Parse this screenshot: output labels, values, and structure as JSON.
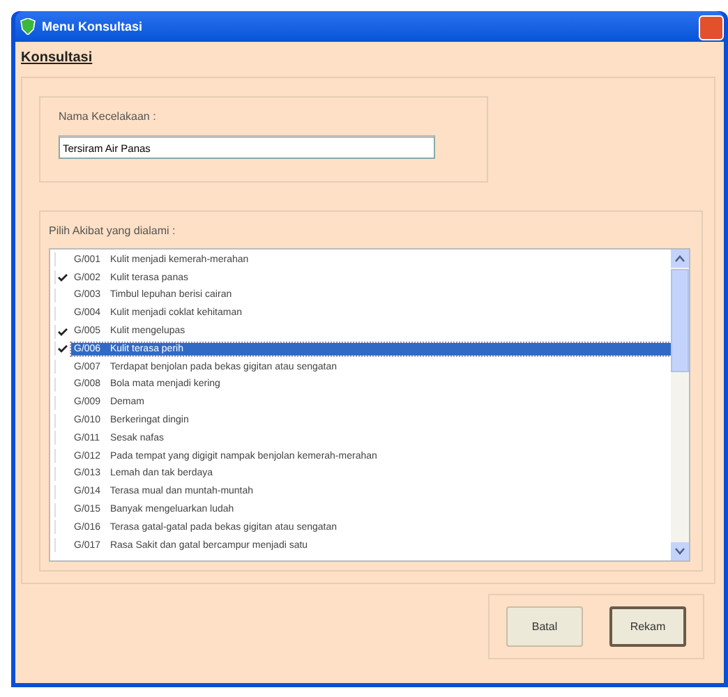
{
  "window": {
    "title": "Menu Konsultasi"
  },
  "heading": "Konsultasi",
  "name_field": {
    "label": "Nama Kecelakaan :",
    "value": "Tersiram Air Panas"
  },
  "list": {
    "label": "Pilih Akibat yang dialami :",
    "items": [
      {
        "code": "G/001",
        "text": "Kulit menjadi kemerah-merahan",
        "checked": false,
        "selected": false
      },
      {
        "code": "G/002",
        "text": "Kulit terasa panas",
        "checked": true,
        "selected": false
      },
      {
        "code": "G/003",
        "text": "Timbul lepuhan berisi cairan",
        "checked": false,
        "selected": false
      },
      {
        "code": "G/004",
        "text": "Kulit menjadi coklat kehitaman",
        "checked": false,
        "selected": false
      },
      {
        "code": "G/005",
        "text": "Kulit mengelupas",
        "checked": true,
        "selected": false
      },
      {
        "code": "G/006",
        "text": "Kulit terasa perih",
        "checked": true,
        "selected": true
      },
      {
        "code": "G/007",
        "text": "Terdapat benjolan pada bekas gigitan atau sengatan",
        "checked": false,
        "selected": false
      },
      {
        "code": "G/008",
        "text": "Bola mata menjadi kering",
        "checked": false,
        "selected": false
      },
      {
        "code": "G/009",
        "text": "Demam",
        "checked": false,
        "selected": false
      },
      {
        "code": "G/010",
        "text": "Berkeringat dingin",
        "checked": false,
        "selected": false
      },
      {
        "code": "G/011",
        "text": "Sesak nafas",
        "checked": false,
        "selected": false
      },
      {
        "code": "G/012",
        "text": "Pada tempat yang digigit nampak benjolan kemerah-merahan",
        "checked": false,
        "selected": false
      },
      {
        "code": "G/013",
        "text": "Lemah dan tak berdaya",
        "checked": false,
        "selected": false
      },
      {
        "code": "G/014",
        "text": "Terasa mual dan muntah-muntah",
        "checked": false,
        "selected": false
      },
      {
        "code": "G/015",
        "text": "Banyak mengeluarkan ludah",
        "checked": false,
        "selected": false
      },
      {
        "code": "G/016",
        "text": "Terasa gatal-gatal pada bekas gigitan atau sengatan",
        "checked": false,
        "selected": false
      },
      {
        "code": "G/017",
        "text": "Rasa Sakit dan gatal bercampur menjadi satu",
        "checked": false,
        "selected": false
      }
    ]
  },
  "buttons": [
    {
      "label": "Batal",
      "default": false
    },
    {
      "label": "Rekam",
      "default": true
    }
  ]
}
